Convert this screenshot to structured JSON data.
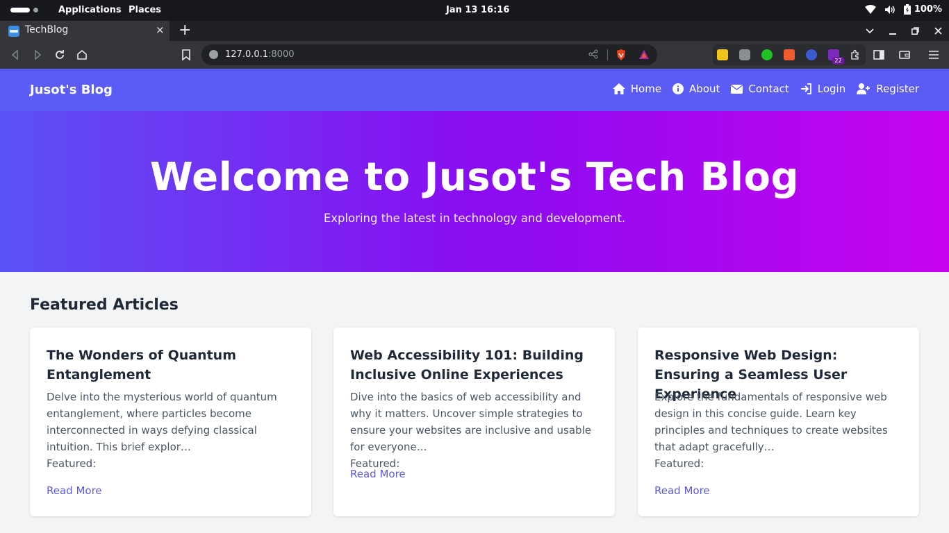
{
  "system_bar": {
    "applications": "Applications",
    "places": "Places",
    "datetime": "Jan 13  16:16",
    "battery": "100%"
  },
  "browser": {
    "tab_title": "TechBlog",
    "tab_close": "×",
    "new_tab": "+",
    "url_host": "127.0.0.1",
    "url_port": ":8000",
    "ext_badge": "22"
  },
  "site": {
    "brand": "Jusot's Blog",
    "nav": {
      "home": "Home",
      "about": "About",
      "contact": "Contact",
      "login": "Login",
      "register": "Register"
    },
    "hero": {
      "title": "Welcome to Jusot's Tech Blog",
      "subtitle": "Exploring the latest in technology and development."
    },
    "featured": {
      "heading": "Featured Articles",
      "cards": [
        {
          "title": "The Wonders of Quantum Entanglement",
          "excerpt": "Delve into the mysterious world of quantum entanglement, where particles become interconnected in ways defying classical intuition. This brief explor…",
          "featured": "Featured:",
          "link": "Read More"
        },
        {
          "title": "Web Accessibility 101: Building Inclusive Online Experiences",
          "excerpt": "Dive into the basics of web accessibility and why it matters. Uncover simple strategies to ensure your websites are inclusive and usable for everyone…",
          "featured": "Featured:",
          "link": "Read More"
        },
        {
          "title": "Responsive Web Design: Ensuring a Seamless User Experience",
          "excerpt": "Explore the fundamentals of responsive web design in this concise guide. Learn key principles and techniques to create websites that adapt gracefully…",
          "featured": "Featured:",
          "link": "Read More"
        }
      ]
    }
  },
  "colors": {
    "nav_bg": "#5b5bf6",
    "hero_gradient": [
      "#5b52f5",
      "#8a0cf1",
      "#c603ee"
    ],
    "link": "#5b5bd6"
  }
}
